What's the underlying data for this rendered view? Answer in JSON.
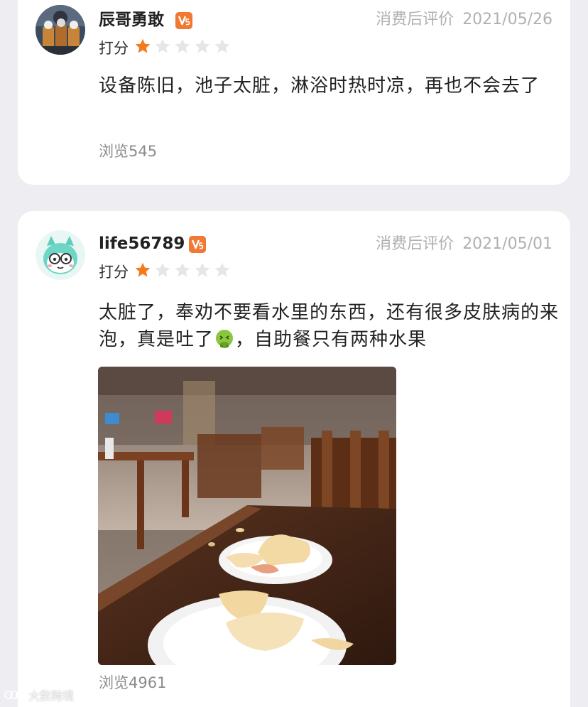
{
  "reviews": [
    {
      "username": "辰哥勇敢",
      "badge_text": "V5",
      "meta_label": "消费后评价",
      "date": "2021/05/26",
      "rating_label": "打分",
      "rating": 1,
      "rating_max": 5,
      "text": "设备陈旧，池子太脏，淋浴时热时凉，再也不会去了",
      "views": "浏览545",
      "avatar_icon": "robot-figures-avatar-icon"
    },
    {
      "username": "life56789",
      "badge_text": "V5",
      "meta_label": "消费后评价",
      "date": "2021/05/01",
      "rating_label": "打分",
      "rating": 1,
      "rating_max": 5,
      "text_part1": "太脏了，奉劝不要看水里的东西，还有很多皮肤病的来泡，真是吐了",
      "text_emoji": "nauseated-face-emoji",
      "text_part2": "，自助餐只有两种水果",
      "views": "浏览4961",
      "avatar_icon": "cartoon-glasses-avatar-icon",
      "photo": "restaurant-table-apple-slices-photo"
    }
  ],
  "watermark": "大数跨境",
  "colors": {
    "star_active": "#f37b1d",
    "star_inactive": "#e6e6ea",
    "badge": "#f07a33",
    "meta": "#b0b0b4",
    "background": "#eeeef2"
  }
}
